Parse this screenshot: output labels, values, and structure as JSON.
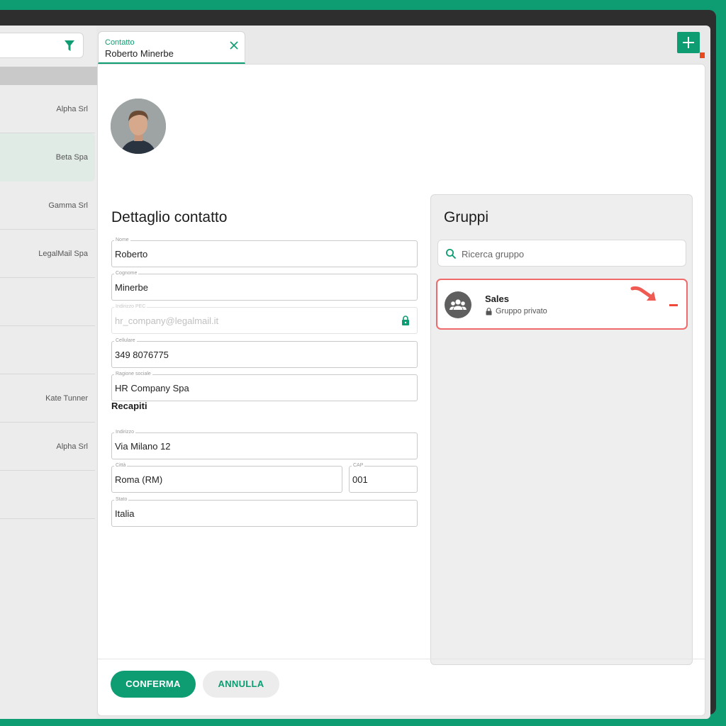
{
  "sidebar": {
    "rows": [
      {
        "text": "Alpha Srl",
        "active": false
      },
      {
        "text": "Beta Spa",
        "active": true
      },
      {
        "text": "Gamma Srl",
        "active": false
      },
      {
        "text": "LegalMail Spa",
        "active": false
      },
      {
        "text": "",
        "active": false
      },
      {
        "text": "",
        "active": false
      },
      {
        "text": "Kate Tunner",
        "active": false
      },
      {
        "text": "Alpha Srl",
        "active": false
      },
      {
        "text": "",
        "active": false
      }
    ]
  },
  "tab": {
    "subtitle": "Contatto",
    "title": "Roberto Minerbe"
  },
  "detail": {
    "title": "Dettaglio contatto",
    "fields": {
      "nome": {
        "label": "Nome",
        "value": "Roberto"
      },
      "cognome": {
        "label": "Cognome",
        "value": "Minerbe"
      },
      "pec": {
        "label": "Indirizzo PEC",
        "value": "hr_company@legalmail.it"
      },
      "cellulare": {
        "label": "Cellulare",
        "value": "349 8076775"
      },
      "ragione": {
        "label": "Ragione sociale",
        "value": "HR Company Spa"
      }
    },
    "recapiti_title": "Recapiti",
    "recapiti": {
      "indirizzo": {
        "label": "Indirizzo",
        "value": "Via Milano 12"
      },
      "citta": {
        "label": "Città",
        "value": "Roma (RM)"
      },
      "cap": {
        "label": "CAP",
        "value": "001"
      },
      "stato": {
        "label": "Stato",
        "value": "Italia"
      }
    }
  },
  "groups": {
    "title": "Gruppi",
    "search_placeholder": "Ricerca gruppo",
    "items": [
      {
        "name": "Sales",
        "type": "Gruppo privato"
      }
    ]
  },
  "footer": {
    "confirm": "CONFERMA",
    "cancel": "ANNULLA"
  },
  "colors": {
    "accent": "#0e9c72",
    "highlight": "#ef6b6b",
    "remove": "#f0493b"
  }
}
